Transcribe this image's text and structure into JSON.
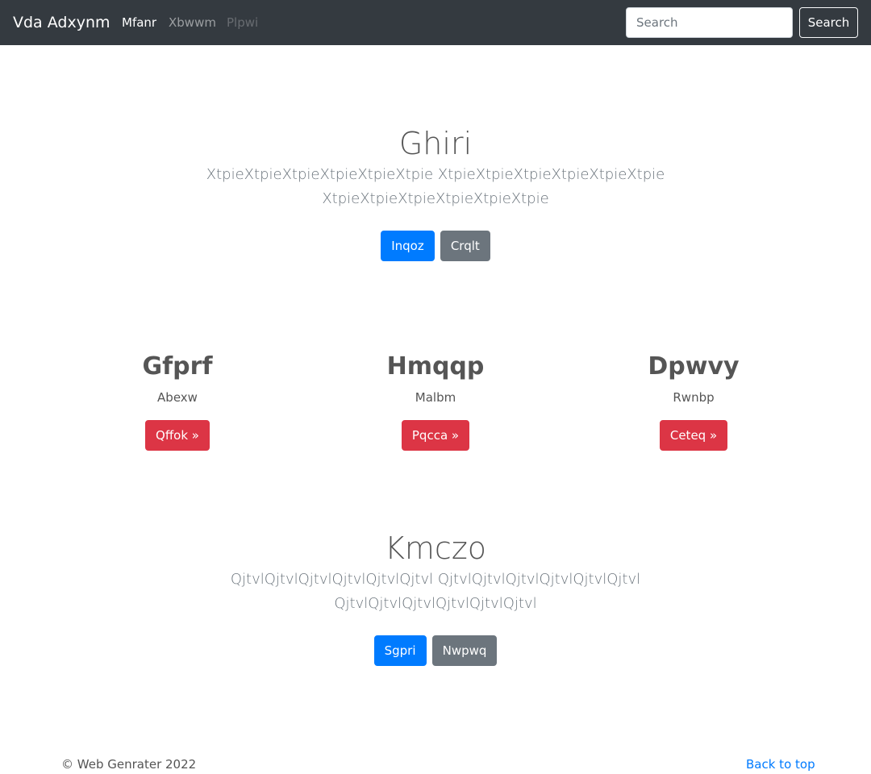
{
  "navbar": {
    "brand": "Vda Adxynm",
    "links": [
      {
        "label": "Mfanr",
        "state": "active"
      },
      {
        "label": "Xbwwm",
        "state": "normal"
      },
      {
        "label": "Plpwi",
        "state": "disabled"
      }
    ],
    "search_placeholder": "Search",
    "search_button": "Search"
  },
  "hero1": {
    "title": "Ghiri",
    "lead_line1": "XtpieXtpieXtpieXtpieXtpieXtpie XtpieXtpieXtpieXtpieXtpieXtpie",
    "lead_line2": "XtpieXtpieXtpieXtpieXtpieXtpie",
    "primary_button": "Inqoz",
    "secondary_button": "Crqlt"
  },
  "columns": [
    {
      "title": "Gfprf",
      "text": "Abexw",
      "button": "Qffok »"
    },
    {
      "title": "Hmqqp",
      "text": "Malbm",
      "button": "Pqcca »"
    },
    {
      "title": "Dpwvy",
      "text": "Rwnbp",
      "button": "Ceteq »"
    }
  ],
  "hero2": {
    "title": "Kmczo",
    "lead_line1": "QjtvlQjtvlQjtvlQjtvlQjtvlQjtvl QjtvlQjtvlQjtvlQjtvlQjtvlQjtvl",
    "lead_line2": "QjtvlQjtvlQjtvlQjtvlQjtvlQjtvl",
    "primary_button": "Sgpri",
    "secondary_button": "Nwpwq"
  },
  "footer": {
    "copyright": "© Web Genrater 2022",
    "back_to_top": "Back to top"
  },
  "colors": {
    "navbar_bg": "#343a40",
    "primary": "#007bff",
    "secondary": "#6c757d",
    "danger": "#dc3545"
  }
}
